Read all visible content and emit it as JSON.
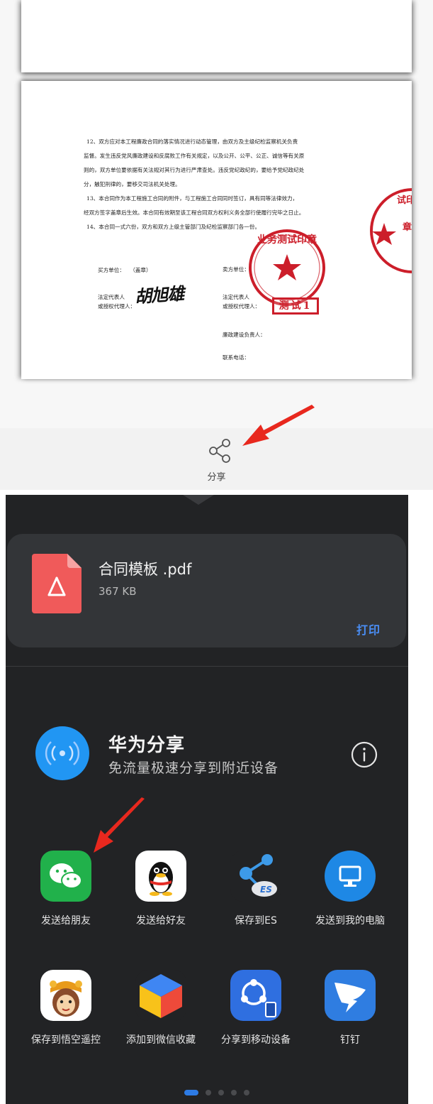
{
  "viewer": {
    "document_paragraphs": [
      "12、双方应对本工程廉政合同的落实情况进行动态管理，由双方及主级纪检监察机关负责",
      "监督。发生违反党风廉政建设和反腐败工作有关规定，以及公开、公平、公正、诚信等有关原",
      "则的，双方单位要依据有关法规对其行为进行严肃查处。违反党纪政纪的，要给予党纪政纪处",
      "分，触犯刑律的，要移交司法机关处理。",
      "13、本合同作为本工程施工合同的附件，与工程施工合同同时签订，具有同等法律效力，",
      "经双方签字盖章后生效。本合同有效期至该工程合同双方权利义务全部行使履行完毕之日止。",
      "14、本合同一式六份，双方和双方上级主管部门及纪检监察部门各一份。"
    ],
    "party_a": {
      "unit_label": "买方单位：",
      "seal_note": "（盖章）",
      "rep_label_1": "法定代表人",
      "rep_label_2": "或授权代理人："
    },
    "party_b": {
      "unit_label": "卖方单位：",
      "rep_label_1": "法定代表人",
      "rep_label_2": "或授权代理人：",
      "integrity_label": "廉政建设负责人：",
      "phone_label": "联系电话："
    },
    "signature": "胡旭雄",
    "stamp_test_text": "测试1",
    "seal_text": "业务测试印章",
    "share_button_label": "分享"
  },
  "share_sheet": {
    "file": {
      "name": "合同模板 .pdf",
      "size": "367 KB",
      "icon": "pdf-file-icon"
    },
    "print_label": "打印",
    "huawei_share": {
      "title": "华为分享",
      "subtitle": "免流量极速分享到附近设备",
      "icon": "huawei-share-icon",
      "info_icon": "info-icon"
    },
    "apps": [
      {
        "label": "发送给朋友",
        "icon": "wechat-icon",
        "color": "#21b14b"
      },
      {
        "label": "发送给好友",
        "icon": "qq-penguin-icon",
        "color": "#ffffff"
      },
      {
        "label": "保存到ES",
        "icon": "es-file-explorer-icon",
        "color": "#222325"
      },
      {
        "label": "发送到我的电脑",
        "icon": "computer-icon",
        "color": "#1e88e5"
      },
      {
        "label": "保存到悟空遥控",
        "icon": "wukong-icon",
        "color": "#ffffff"
      },
      {
        "label": "添加到微信收藏",
        "icon": "cube-icon",
        "color": "#222325"
      },
      {
        "label": "分享到移动设备",
        "icon": "mobile-share-icon",
        "color": "#2f6fe0"
      },
      {
        "label": "钉钉",
        "icon": "dingtalk-icon",
        "color": "#2f7de1"
      }
    ],
    "page_dots": 5,
    "active_dot": 0
  }
}
